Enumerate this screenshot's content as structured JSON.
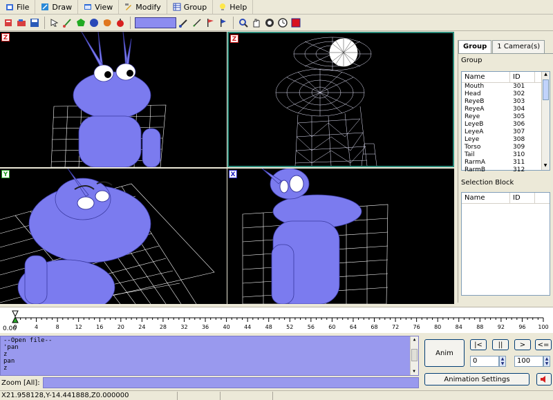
{
  "menu": [
    {
      "label": "File",
      "icon": "file-icon"
    },
    {
      "label": "Draw",
      "icon": "draw-icon"
    },
    {
      "label": "View",
      "icon": "view-icon"
    },
    {
      "label": "Modify",
      "icon": "modify-icon"
    },
    {
      "label": "Group",
      "icon": "group-icon"
    },
    {
      "label": "Help",
      "icon": "help-icon"
    }
  ],
  "viewports": {
    "top_left": {
      "axis": "Z",
      "tag_color": "#d42020"
    },
    "top_right": {
      "axis": "Z",
      "tag_color": "#d42020"
    },
    "bottom_left": {
      "axis": "Y",
      "tag_color": "#20a020"
    },
    "bottom_right": {
      "axis": "X",
      "tag_color": "#2020c0"
    }
  },
  "panel": {
    "tabs": [
      "Group",
      "1 Camera(s)"
    ],
    "group_label": "Group",
    "columns": [
      "Name",
      "ID"
    ],
    "groups": [
      {
        "name": "Mouth",
        "id": "301"
      },
      {
        "name": "Head",
        "id": "302"
      },
      {
        "name": "ReyeB",
        "id": "303"
      },
      {
        "name": "ReyeA",
        "id": "304"
      },
      {
        "name": "Reye",
        "id": "305"
      },
      {
        "name": "LeyeB",
        "id": "306"
      },
      {
        "name": "LeyeA",
        "id": "307"
      },
      {
        "name": "Leye",
        "id": "308"
      },
      {
        "name": "Torso",
        "id": "309"
      },
      {
        "name": "Tail",
        "id": "310"
      },
      {
        "name": "RarmA",
        "id": "311"
      },
      {
        "name": "RarmB",
        "id": "312"
      }
    ],
    "selection_label": "Selection Block",
    "selection_columns": [
      "Name",
      "ID"
    ]
  },
  "timeline": {
    "start_label": "0.00",
    "ticks": [
      "0",
      "4",
      "8",
      "12",
      "16",
      "20",
      "24",
      "28",
      "32",
      "36",
      "40",
      "44",
      "48",
      "52",
      "56",
      "60",
      "64",
      "68",
      "72",
      "76",
      "80",
      "84",
      "88",
      "92",
      "96",
      "100"
    ]
  },
  "console": {
    "lines": [
      "--Open file--",
      "'pan",
      "z",
      "pan",
      "z"
    ],
    "zoom_label": "Zoom [All]:"
  },
  "anim": {
    "anim_label": "Anim",
    "first_label": "|<",
    "pause_label": "||",
    "play_label": ">",
    "loop_label": "<=",
    "start_value": "0",
    "end_value": "100",
    "settings_label": "Animation Settings"
  },
  "status": {
    "coords": "X21.958128,Y-14.441888,Z0.000000"
  },
  "colors": {
    "model": "#7b7bef",
    "model_shade": "#4a4ac0",
    "grid": "#ffffff",
    "selected_border": "#2a8a7a",
    "console_bg": "#9999ee"
  }
}
